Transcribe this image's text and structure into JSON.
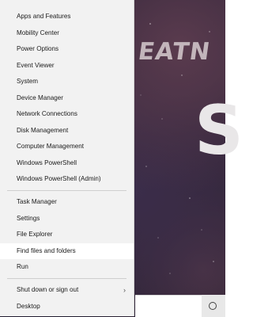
{
  "background": {
    "brand_text": "EATN",
    "big_glyph": "S"
  },
  "menu": {
    "group1": [
      {
        "label": "Apps and Features"
      },
      {
        "label": "Mobility Center"
      },
      {
        "label": "Power Options"
      },
      {
        "label": "Event Viewer"
      },
      {
        "label": "System"
      },
      {
        "label": "Device Manager"
      },
      {
        "label": "Network Connections"
      },
      {
        "label": "Disk Management"
      },
      {
        "label": "Computer Management"
      },
      {
        "label": "Windows PowerShell"
      },
      {
        "label": "Windows PowerShell (Admin)"
      }
    ],
    "group2": [
      {
        "label": "Task Manager"
      },
      {
        "label": "Settings"
      },
      {
        "label": "File Explorer"
      },
      {
        "label": "Find files and folders"
      },
      {
        "label": "Run"
      }
    ],
    "group3": [
      {
        "label": "Shut down or sign out",
        "chevron": "›"
      },
      {
        "label": "Desktop"
      }
    ]
  },
  "taskbar": {
    "search_icon": "cortana-circle-icon"
  }
}
